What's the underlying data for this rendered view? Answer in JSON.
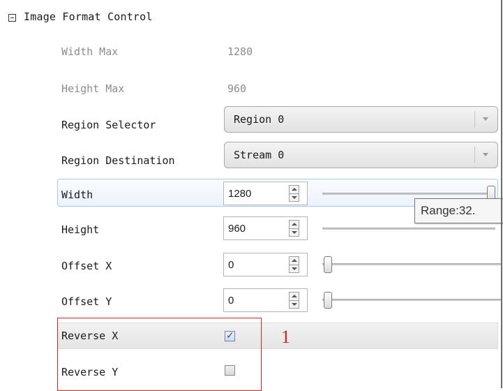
{
  "section": {
    "title": "Image Format Control",
    "collapsed": false,
    "toggle_icon": "minus-box-icon"
  },
  "readonly": [
    {
      "label": "Width Max",
      "value": "1280"
    },
    {
      "label": "Height Max",
      "value": "960"
    }
  ],
  "combos": [
    {
      "label": "Region Selector",
      "value": "Region 0"
    },
    {
      "label": "Region Destination",
      "value": "Stream 0"
    }
  ],
  "numeric": [
    {
      "label": "Width",
      "value": "1280",
      "slider_fraction": 1.0,
      "selected": true
    },
    {
      "label": "Height",
      "value": "960",
      "slider_fraction": 1.0,
      "selected": false
    },
    {
      "label": "Offset X",
      "value": "0",
      "slider_fraction": 0.0,
      "selected": false
    },
    {
      "label": "Offset Y",
      "value": "0",
      "slider_fraction": 0.0,
      "selected": false
    }
  ],
  "tooltip": {
    "text": "Range:32."
  },
  "checkboxes": [
    {
      "label": "Reverse X",
      "checked": true
    },
    {
      "label": "Reverse Y",
      "checked": false
    }
  ],
  "annotation": {
    "text": "1",
    "color": "#e02020"
  },
  "colors": {
    "selection_border": "#a6c8ee",
    "readonly_text": "#8c8c8c"
  }
}
